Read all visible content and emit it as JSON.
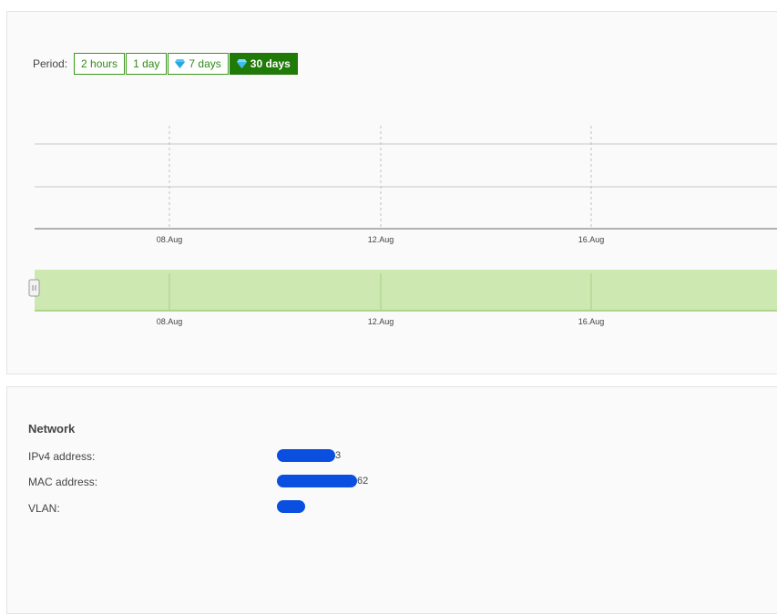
{
  "period": {
    "label": "Period:",
    "options": [
      "2 hours",
      "1 day",
      "7 days",
      "30 days"
    ],
    "selected": "30 days"
  },
  "chart_data": {
    "type": "line",
    "series": [],
    "x_ticks": [
      "08.Aug",
      "12.Aug",
      "16.Aug"
    ],
    "navigator_ticks": [
      "08.Aug",
      "12.Aug",
      "16.Aug"
    ],
    "grid": true
  },
  "network": {
    "title": "Network",
    "rows": [
      {
        "label": "IPv4 address:",
        "value_suffix": "3"
      },
      {
        "label": "MAC address:",
        "value_suffix": "62"
      },
      {
        "label": "VLAN:",
        "value_suffix": ""
      }
    ]
  },
  "colors": {
    "accent": "#1f7a08",
    "navigator_fill": "#cde8b0",
    "redaction": "#0a4fe0"
  }
}
